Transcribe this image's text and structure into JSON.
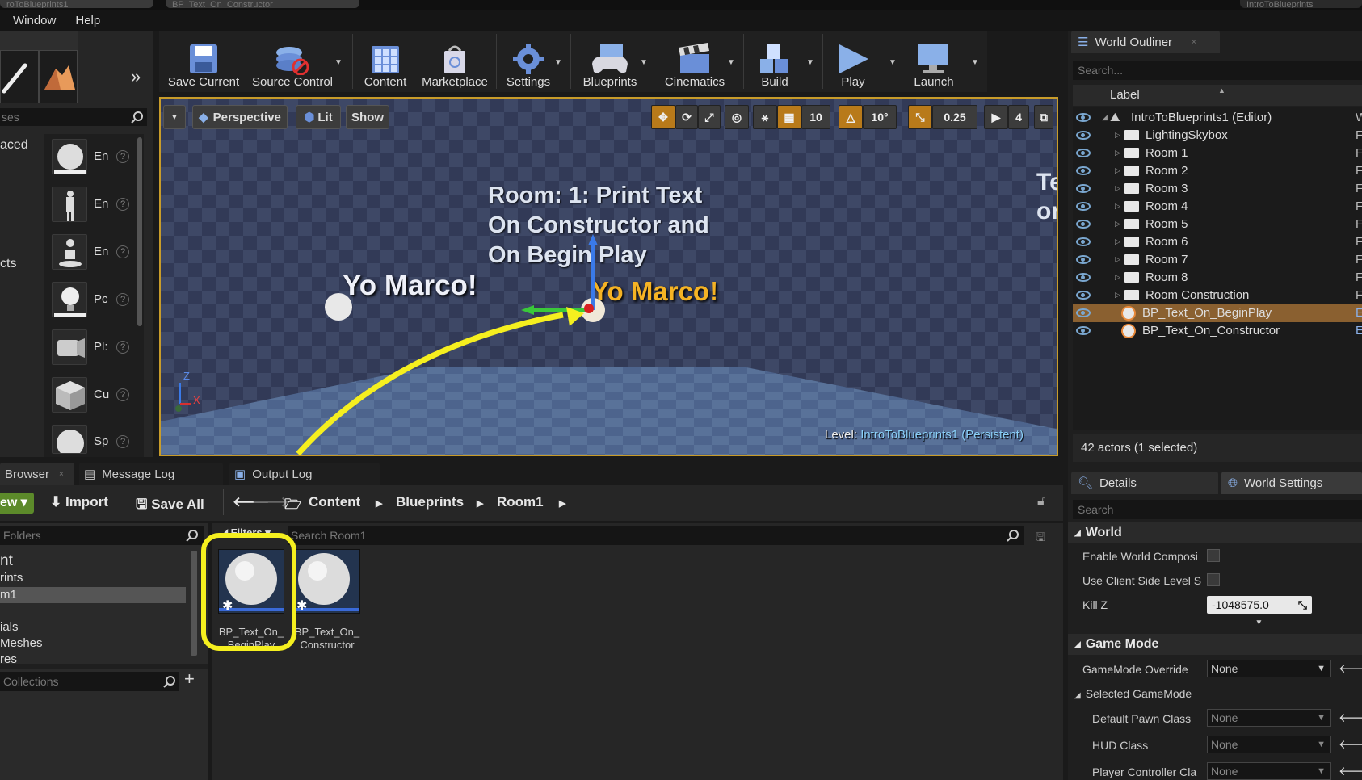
{
  "top_tabs": [
    "roToBlueprints1",
    "BP_Text_On_Constructor",
    "IntroToBlueprints"
  ],
  "menu": [
    "Window",
    "Help"
  ],
  "left_panel": {
    "search_placeholder": "ses",
    "categories": [
      "aced",
      "cts"
    ],
    "items": [
      "En",
      "En",
      "En",
      "Pc",
      "Pl:",
      "Cu",
      "Sp"
    ],
    "help_glyph": "?"
  },
  "toolbar": {
    "buttons": [
      "Save Current",
      "Source Control",
      "Content",
      "Marketplace",
      "Settings",
      "Blueprints",
      "Cinematics",
      "Build",
      "Play",
      "Launch"
    ]
  },
  "viewport": {
    "perspective": "Perspective",
    "lit": "Lit",
    "show": "Show",
    "grid_snap": "10",
    "rot_snap": "10°",
    "scale_snap": "0.25",
    "cam_speed": "4",
    "wall_text": [
      "Room: 1: Print Text",
      "On Constructor and",
      "On Begin Play"
    ],
    "yo_left": "Yo Marco!",
    "yo_right": "Yo Marco!",
    "partial_right": [
      "Te",
      "on"
    ],
    "level_label": "Level:",
    "level_name": "IntroToBlueprints1 (Persistent)",
    "axis_z": "Z",
    "axis_x": "X",
    "accent": "#f5ef1f",
    "text_orange": "#f5b324"
  },
  "bottom_tabs": [
    "Browser",
    "Message Log",
    "Output Log"
  ],
  "content_browser": {
    "add_new": "ew",
    "import": "Import",
    "save_all": "Save All",
    "path": [
      "Content",
      "Blueprints",
      "Room1"
    ],
    "folders_placeholder": "Folders",
    "filters": "Filters",
    "search_placeholder": "Search Room1",
    "tree": [
      "nt",
      "rints",
      "m1",
      "ials",
      "Meshes",
      "res"
    ],
    "collections": "Collections",
    "assets": [
      {
        "line1": "BP_Text_On_",
        "line2": "BeginPlay"
      },
      {
        "line1": "BP_Text_On_",
        "line2": "Constructor"
      }
    ]
  },
  "world_outliner": {
    "tab": "World Outliner",
    "search_placeholder": "Search...",
    "label_header": "Label",
    "rows": [
      {
        "label": "IntroToBlueprints1 (Editor)",
        "kind": "world",
        "right": "W"
      },
      {
        "label": "LightingSkybox",
        "kind": "folder",
        "right": "F"
      },
      {
        "label": "Room 1",
        "kind": "folder",
        "right": "F"
      },
      {
        "label": "Room 2",
        "kind": "folder",
        "right": "F"
      },
      {
        "label": "Room 3",
        "kind": "folder",
        "right": "F"
      },
      {
        "label": "Room 4",
        "kind": "folder",
        "right": "F"
      },
      {
        "label": "Room 5",
        "kind": "folder",
        "right": "F"
      },
      {
        "label": "Room 6",
        "kind": "folder",
        "right": "F"
      },
      {
        "label": "Room 7",
        "kind": "folder",
        "right": "F"
      },
      {
        "label": "Room 8",
        "kind": "folder",
        "right": "F"
      },
      {
        "label": "Room Construction",
        "kind": "folder",
        "right": "F"
      },
      {
        "label": "BP_Text_On_BeginPlay",
        "kind": "actor",
        "right": "E",
        "selected": true
      },
      {
        "label": "BP_Text_On_Constructor",
        "kind": "actor",
        "right": "E"
      }
    ],
    "status": "42 actors (1 selected)"
  },
  "details": {
    "tab_details": "Details",
    "tab_world_settings": "World Settings",
    "search_placeholder": "Search",
    "section_world": "World",
    "enable_world_comp": "Enable World Composi",
    "use_client_side": "Use Client Side Level S",
    "kill_z_label": "Kill Z",
    "kill_z_value": "-1048575.0",
    "section_game_mode": "Game Mode",
    "gamemode_override": "GameMode Override",
    "gamemode_value": "None",
    "selected_gamemode": "Selected GameMode",
    "default_pawn": "Default Pawn Class",
    "default_pawn_value": "None",
    "hud_class": "HUD Class",
    "hud_value": "None",
    "player_controller": "Player Controller Cla",
    "player_controller_value": "None"
  }
}
